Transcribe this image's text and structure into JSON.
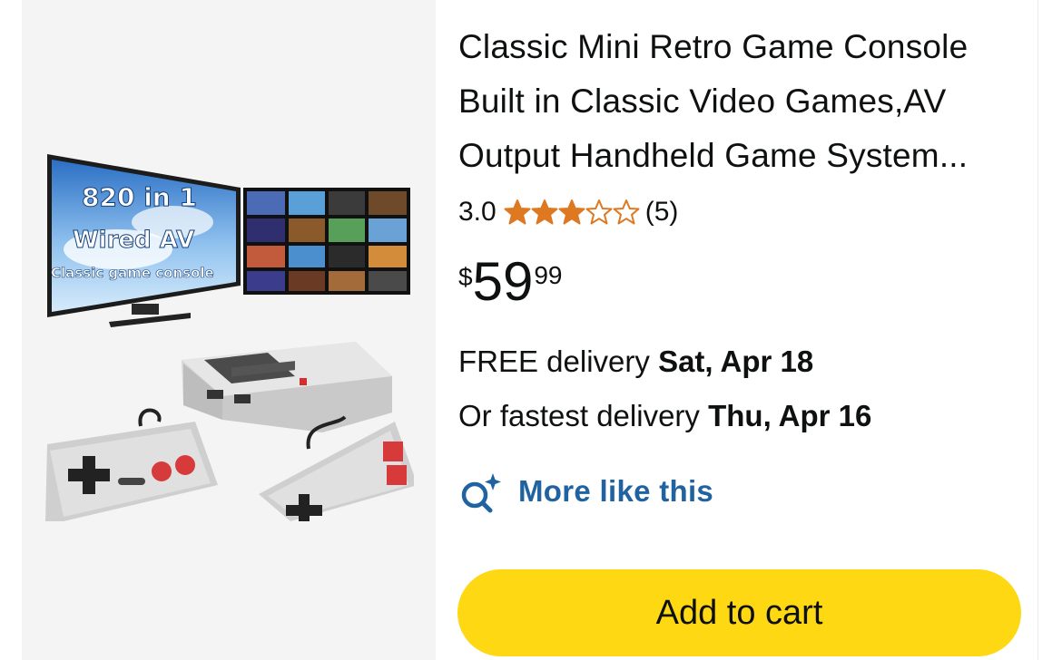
{
  "product": {
    "title": "Classic Mini Retro Game Console Built in Classic Video Games,AV Output Handheld Game System...",
    "rating_value": "3.0",
    "rating_stars": 3,
    "rating_max": 5,
    "review_count": "(5)",
    "price": {
      "currency": "$",
      "whole": "59",
      "fraction": "99"
    },
    "image": {
      "overlay_line1": "820 in 1",
      "overlay_line2": "Wired AV",
      "overlay_line3": "Classic game console",
      "icon": "retro-console-product-image"
    }
  },
  "delivery": {
    "free_prefix": "FREE delivery ",
    "free_date": "Sat, Apr 18",
    "fastest_prefix": "Or fastest delivery ",
    "fastest_date": "Thu, Apr 16"
  },
  "actions": {
    "more_like_this": "More like this",
    "add_to_cart": "Add to cart"
  },
  "colors": {
    "star": "#de7921",
    "link": "#2162a1",
    "cart_button": "#ffd814",
    "image_bg": "#f4f4f4"
  }
}
